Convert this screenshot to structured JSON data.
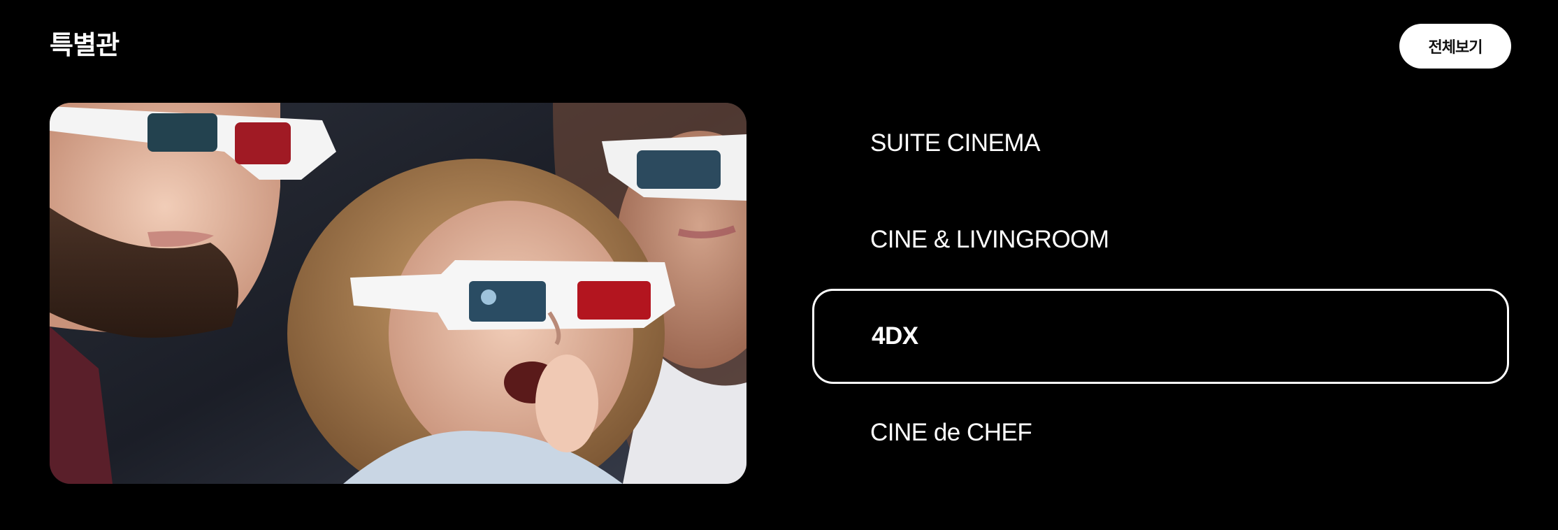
{
  "section": {
    "title": "특별관",
    "view_all_label": "전체보기"
  },
  "hero": {
    "image": "3d-glasses-family-photo",
    "alt": "3D glasses family photo"
  },
  "halls": [
    {
      "label": "SUITE CINEMA",
      "active": false
    },
    {
      "label": "CINE & LIVINGROOM",
      "active": false
    },
    {
      "label": "4DX",
      "active": true
    },
    {
      "label": "CINE de CHEF",
      "active": false
    }
  ],
  "colors": {
    "background": "#000000",
    "text": "#ffffff",
    "button_bg": "#ffffff",
    "button_text": "#111111",
    "active_border": "#ffffff"
  }
}
